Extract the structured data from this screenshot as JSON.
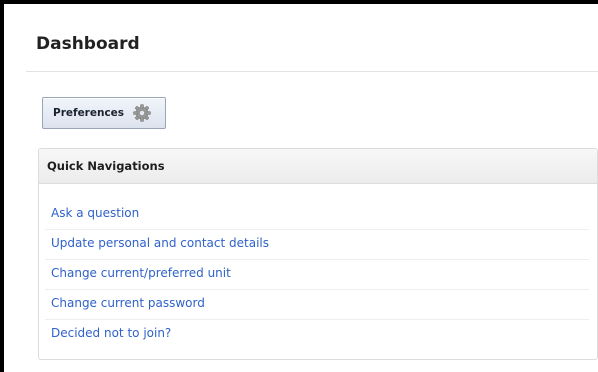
{
  "header": {
    "title": "Dashboard"
  },
  "toolbar": {
    "preferences_label": "Preferences",
    "preferences_icon": "gear-icon"
  },
  "quick_navigations": {
    "title": "Quick Navigations",
    "links": [
      {
        "label": "Ask a question"
      },
      {
        "label": "Update personal and contact details"
      },
      {
        "label": "Change current/preferred unit"
      },
      {
        "label": "Change current password"
      },
      {
        "label": "Decided not to join?"
      }
    ]
  },
  "colors": {
    "link": "#2f62c9",
    "button_border": "#9aa6b8",
    "panel_border": "#dcdcdc"
  }
}
